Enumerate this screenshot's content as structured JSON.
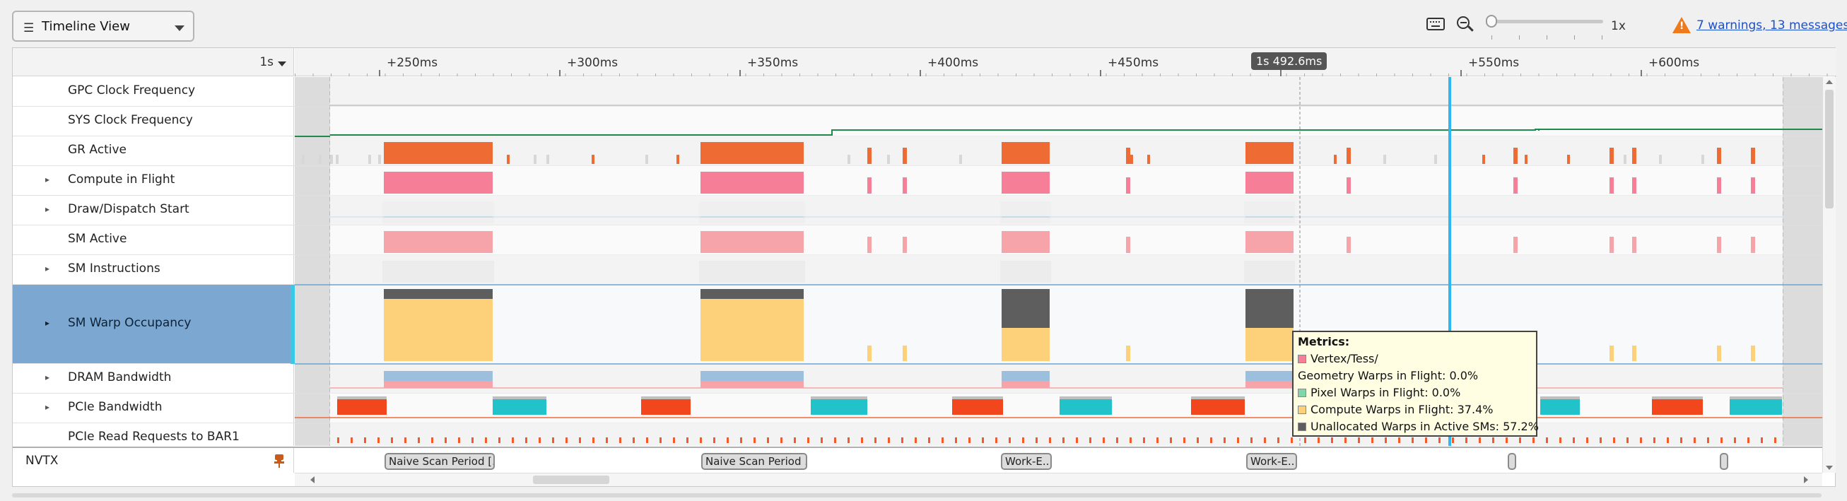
{
  "toolbar": {
    "view_select": "Timeline View",
    "zoom_level": "1x",
    "warnings_link": "7 warnings, 13 messages"
  },
  "ruler": {
    "scale": "1s",
    "ticks": [
      "+250ms",
      "+300ms",
      "+350ms",
      "+400ms",
      "+450ms",
      "+550ms",
      "+600ms"
    ],
    "cursor_label": "1s 492.6ms"
  },
  "rows": [
    {
      "label": "GPC Clock Frequency",
      "expandable": false
    },
    {
      "label": "SYS Clock Frequency",
      "expandable": false
    },
    {
      "label": "GR Active",
      "expandable": false
    },
    {
      "label": "Compute in Flight",
      "expandable": true
    },
    {
      "label": "Draw/Dispatch Start",
      "expandable": true
    },
    {
      "label": "SM Active",
      "expandable": false
    },
    {
      "label": "SM Instructions",
      "expandable": true
    },
    {
      "label": "SM Warp Occupancy",
      "expandable": true
    },
    {
      "label": "DRAM Bandwidth",
      "expandable": true
    },
    {
      "label": "PCIe Bandwidth",
      "expandable": true
    },
    {
      "label": "PCIe Read Requests to BAR1",
      "expandable": false
    }
  ],
  "nvtx": {
    "label": "NVTX",
    "ranges": [
      "Naive Scan Period [...",
      "Naive Scan Period ...",
      "Work-E...",
      "Work-E..."
    ]
  },
  "tooltip": {
    "title": "Metrics:",
    "lines": [
      "Vertex/Tess/",
      "Geometry Warps in Flight: 0.0%",
      "Pixel Warps in Flight: 0.0%",
      "Compute Warps in Flight: 37.4%",
      "Unallocated Warps in Active SMs: 57.2%"
    ]
  },
  "colors": {
    "gr_active": "#ee6c34",
    "compute": "#f77e97",
    "sm_active": "#f7a3aa",
    "warp_compute": "#fdd07a",
    "warp_unalloc": "#5e5e5e",
    "dram": "#9bbfdc",
    "pcie_red": "#f2461c",
    "pcie_cyan": "#21c2c9",
    "clock": "#1f8a4c",
    "cursor": "#2fb8f0",
    "selected_row": "#7ba7d1"
  }
}
